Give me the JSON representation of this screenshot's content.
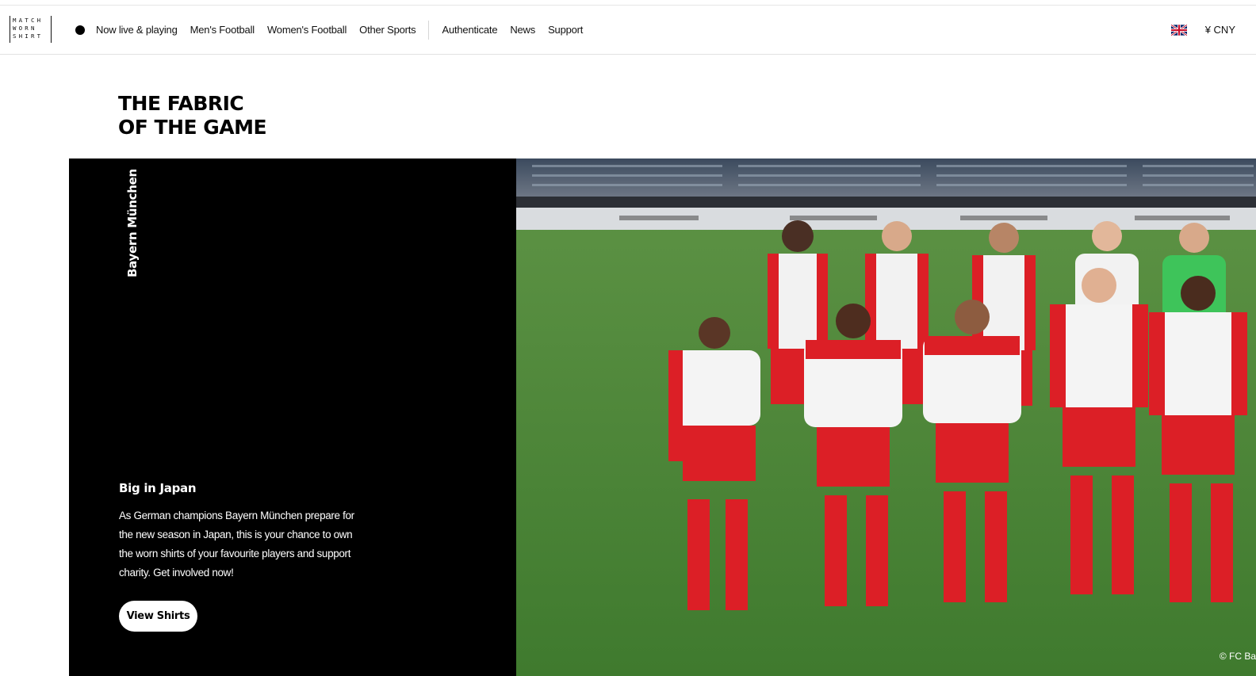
{
  "brand": {
    "logo_lines": [
      "MATCH",
      "WORN",
      "SHIRT"
    ]
  },
  "nav": {
    "live_label": "Now live & playing",
    "items": [
      {
        "label": "Men's Football"
      },
      {
        "label": "Women's Football"
      },
      {
        "label": "Other Sports"
      }
    ],
    "secondary": [
      {
        "label": "Authenticate"
      },
      {
        "label": "News"
      },
      {
        "label": "Support"
      }
    ]
  },
  "tools": {
    "language_icon": "uk-flag-icon",
    "currency": "¥  CNY"
  },
  "hero": {
    "headline_lines": [
      "THE FABRIC",
      "OF THE GAME"
    ],
    "team": "Bayern München",
    "title": "Big in Japan",
    "text": "As German champions Bayern München prepare for the new season in Japan, this is your chance to own the worn shirts of your favourite players and support charity. Get involved now!",
    "button_label": "View Shirts",
    "photo_credit": "© FC Ba"
  },
  "colors": {
    "accent_red": "#dc1f26",
    "pitch_green": "#4f8a3a",
    "dark_panel": "#000000"
  }
}
